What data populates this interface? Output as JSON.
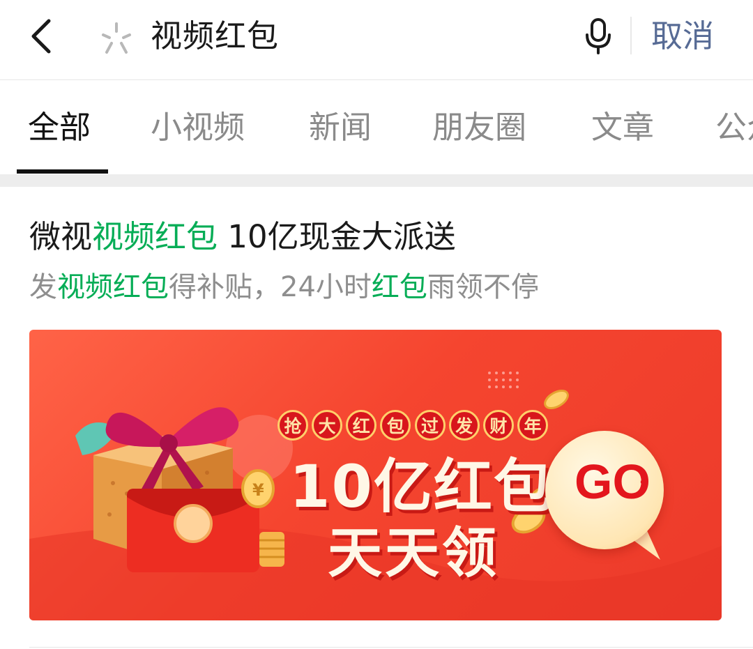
{
  "search": {
    "query": "视频红包",
    "cancel_label": "取消"
  },
  "tabs": [
    {
      "label": "全部",
      "active": true
    },
    {
      "label": "小视频",
      "active": false
    },
    {
      "label": "新闻",
      "active": false
    },
    {
      "label": "朋友圈",
      "active": false
    },
    {
      "label": "文章",
      "active": false
    },
    {
      "label": "公众号",
      "active": false
    }
  ],
  "result": {
    "title": {
      "prefix": "微视",
      "highlight": "视频红包",
      "suffix": " 10亿现金大派送"
    },
    "description": {
      "part1": "发",
      "highlight1": "视频红包",
      "part2": "得补贴，24小时",
      "highlight2": "红包",
      "part3": "雨领不停"
    },
    "banner": {
      "slogan_chars": [
        "抢",
        "大",
        "红",
        "包",
        "过",
        "发",
        "财",
        "年"
      ],
      "headline_line1": "10亿红包",
      "headline_line2": "天天领",
      "go_label": "GO",
      "go_chevron": "›"
    }
  },
  "colors": {
    "highlight": "#06ad56",
    "cancel_link": "#576b95",
    "banner_red": "#f5452f"
  },
  "icons": {
    "back": "chevron-left-icon",
    "search": "wechat-search-icon",
    "mic": "microphone-icon"
  }
}
